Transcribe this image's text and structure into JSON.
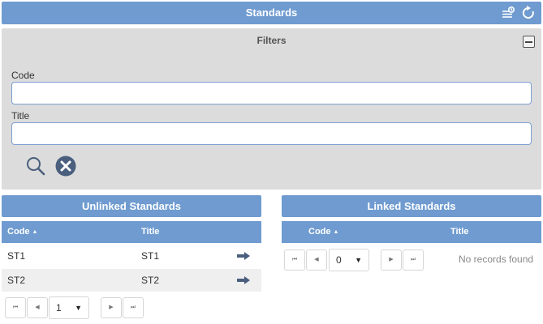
{
  "header": {
    "title": "Standards",
    "icons": [
      "history-list-icon",
      "refresh-icon"
    ]
  },
  "filters": {
    "title": "Filters",
    "code_label": "Code",
    "code_value": "",
    "title_label": "Title",
    "title_value": "",
    "actions": [
      "search-icon",
      "clear-icon"
    ]
  },
  "unlinked": {
    "title": "Unlinked Standards",
    "columns": {
      "code": "Code",
      "title": "Title"
    },
    "sort_indicator": "▲",
    "rows": [
      {
        "code": "ST1",
        "title": "ST1"
      },
      {
        "code": "ST2",
        "title": "ST2"
      }
    ],
    "pager": {
      "first": "⏮",
      "prev": "◀",
      "page": "1",
      "caret": "▼",
      "next": "▶",
      "last": "⏭"
    }
  },
  "linked": {
    "title": "Linked Standards",
    "columns": {
      "code": "Code",
      "title": "Title"
    },
    "sort_indicator": "▲",
    "empty_text": "No records found",
    "pager": {
      "first": "⏮",
      "prev": "◀",
      "page": "0",
      "caret": "▼",
      "next": "▶",
      "last": "⏭"
    }
  },
  "colors": {
    "accent": "#6f9bd0",
    "filters_bg": "#dcdcdc",
    "row_alt": "#efefef",
    "icon_dark": "#4a5f7e"
  }
}
